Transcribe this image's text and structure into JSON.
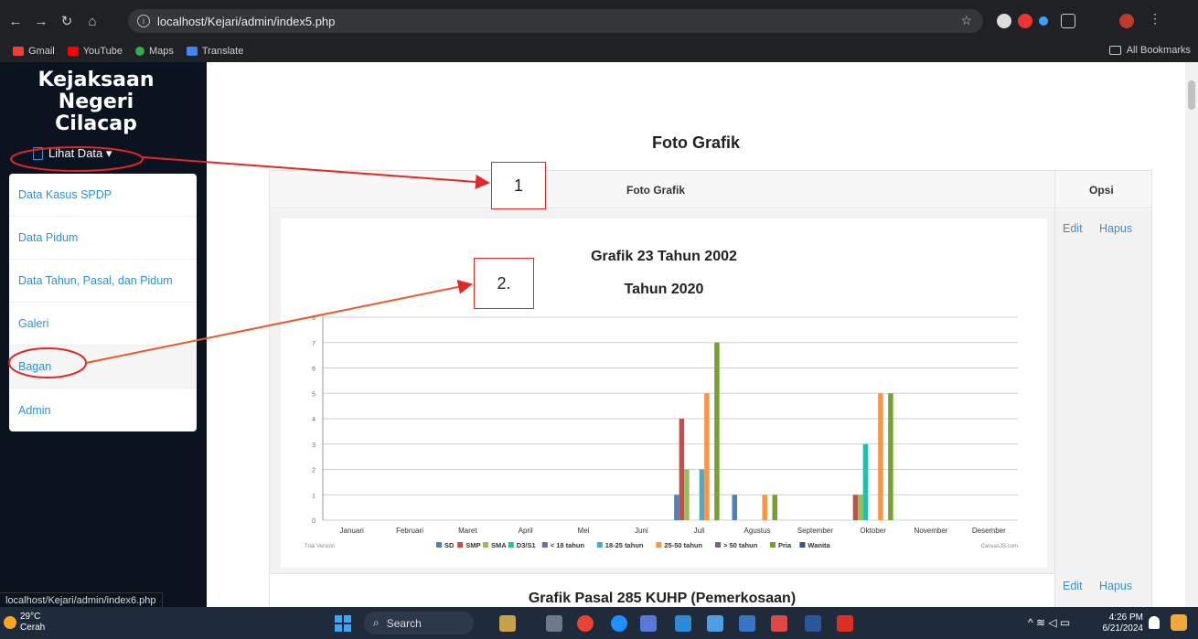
{
  "browser": {
    "url": "localhost/Kejari/admin/index5.php",
    "bookmarks": [
      "Gmail",
      "YouTube",
      "Maps",
      "Translate"
    ],
    "all_bookmarks": "All Bookmarks",
    "status_url": "localhost/Kejari/admin/index6.php"
  },
  "sidebar": {
    "brand_line1": "Kejaksaan Negeri",
    "brand_line2": "Cilacap",
    "dropdown_label": "Lihat Data ▾",
    "items": [
      {
        "label": "Data Kasus SPDP"
      },
      {
        "label": "Data Pidum"
      },
      {
        "label": "Data Tahun, Pasal, dan Pidum"
      },
      {
        "label": "Galeri"
      },
      {
        "label": "Bagan"
      },
      {
        "label": "Admin"
      }
    ]
  },
  "main": {
    "page_title": "Foto Grafik",
    "table": {
      "headers": [
        "Foto Grafik",
        "Opsi"
      ],
      "edit_label": "Edit",
      "delete_label": "Hapus",
      "next_row_title": "Grafik Pasal 285 KUHP (Pemerkosaan)"
    }
  },
  "annotations": {
    "box1": "1",
    "box2": "2."
  },
  "chart_data": {
    "type": "bar",
    "title": "Grafik 23 Tahun 2002",
    "subtitle": "Tahun 2020",
    "categories": [
      "Januari",
      "Februari",
      "Maret",
      "April",
      "Mei",
      "Juni",
      "Juli",
      "Agustus",
      "September",
      "Oktober",
      "November",
      "Desember"
    ],
    "ylim": [
      0,
      8
    ],
    "yticks": [
      0,
      1,
      2,
      3,
      4,
      5,
      6,
      7,
      8
    ],
    "grid": true,
    "legend_position": "bottom",
    "footer_left": "Trial Version",
    "footer_right": "CanvasJS.com",
    "series": [
      {
        "name": "SD",
        "color": "#4f81bc",
        "values": [
          0,
          0,
          0,
          0,
          0,
          0,
          1,
          1,
          0,
          0,
          0,
          0
        ]
      },
      {
        "name": "SMP",
        "color": "#c0504e",
        "values": [
          0,
          0,
          0,
          0,
          0,
          0,
          4,
          0,
          0,
          1,
          0,
          0
        ]
      },
      {
        "name": "SMA",
        "color": "#9bbb58",
        "values": [
          0,
          0,
          0,
          0,
          0,
          0,
          2,
          0,
          0,
          1,
          0,
          0
        ]
      },
      {
        "name": "D3/S1",
        "color": "#23bfaa",
        "values": [
          0,
          0,
          0,
          0,
          0,
          0,
          0,
          0,
          0,
          3,
          0,
          0
        ]
      },
      {
        "name": "< 18 tahun",
        "color": "#8064a1",
        "values": [
          0,
          0,
          0,
          0,
          0,
          0,
          0,
          0,
          0,
          0,
          0,
          0
        ]
      },
      {
        "name": "18-25 tahun",
        "color": "#4aacc5",
        "values": [
          0,
          0,
          0,
          0,
          0,
          0,
          2,
          0,
          0,
          0,
          0,
          0
        ]
      },
      {
        "name": "25-50 tahun",
        "color": "#f79647",
        "values": [
          0,
          0,
          0,
          0,
          0,
          0,
          5,
          1,
          0,
          5,
          0,
          0
        ]
      },
      {
        "name": "> 50 tahun",
        "color": "#7f6084",
        "values": [
          0,
          0,
          0,
          0,
          0,
          0,
          0,
          0,
          0,
          0,
          0,
          0
        ]
      },
      {
        "name": "Pria",
        "color": "#77a033",
        "values": [
          0,
          0,
          0,
          0,
          0,
          0,
          7,
          1,
          0,
          5,
          0,
          0
        ]
      },
      {
        "name": "Wanita",
        "color": "#33558b",
        "values": [
          0,
          0,
          0,
          0,
          0,
          0,
          0,
          0,
          0,
          0,
          0,
          0
        ]
      }
    ]
  },
  "taskbar": {
    "temperature": "29°C",
    "weather": "Cerah",
    "search_label": "Search",
    "time": "4:26 PM",
    "date": "6/21/2024"
  }
}
